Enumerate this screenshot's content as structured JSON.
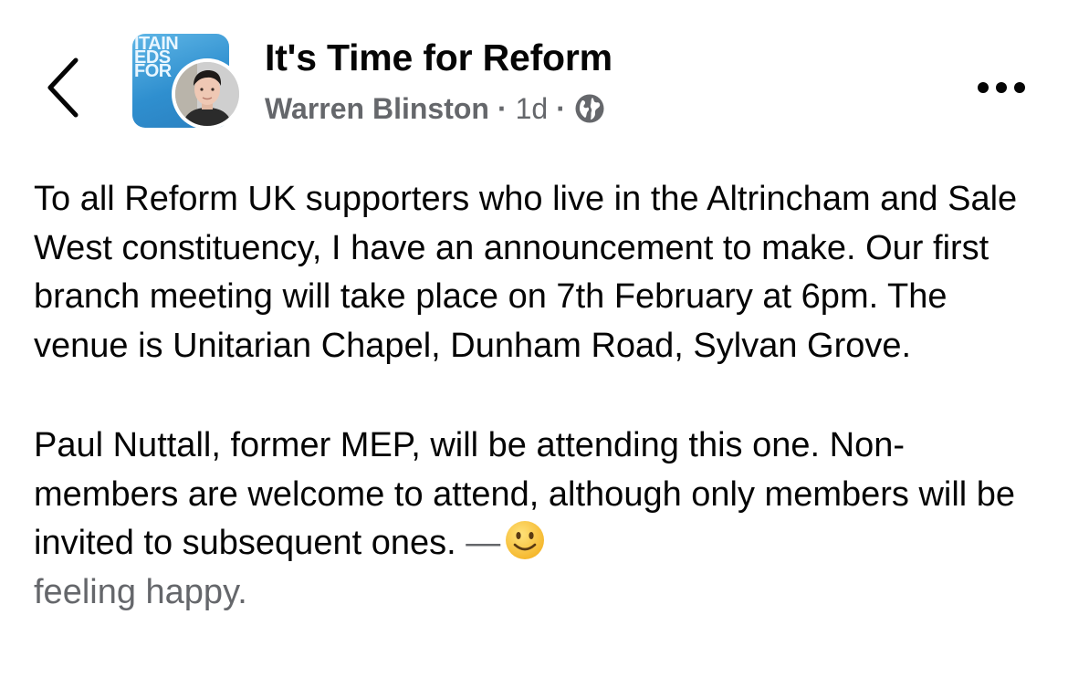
{
  "header": {
    "group_name": "It's Time for Reform",
    "author": "Warren Blinston",
    "separator": "·",
    "time_ago": "1d",
    "privacy_icon": "globe-icon",
    "back_icon": "chevron-left-icon",
    "more_icon": "more-horizontal-icon",
    "cover_text": [
      "ITAIN",
      "EDS",
      "FOR"
    ]
  },
  "post": {
    "paragraph_1": "To all Reform UK supporters who live in the Altrincham and Sale West constituency, I have an announcement to make.  Our first branch meeting will take place on 7th February at 6pm.  The venue is Unitarian Chapel, Dunham Road, Sylvan Grove.",
    "paragraph_2": "Paul Nuttall, former MEP, will be attending this one. Non-members are welcome to attend, although only members will be invited to subsequent ones.",
    "feeling_dash": "—",
    "feeling_icon": "smiling-face-icon",
    "feeling_text": "feeling happy."
  },
  "colors": {
    "primary_text": "#050505",
    "secondary_text": "#65676b",
    "group_cover": "#2f8fcf",
    "emoji_yellow": "#f7c948"
  }
}
